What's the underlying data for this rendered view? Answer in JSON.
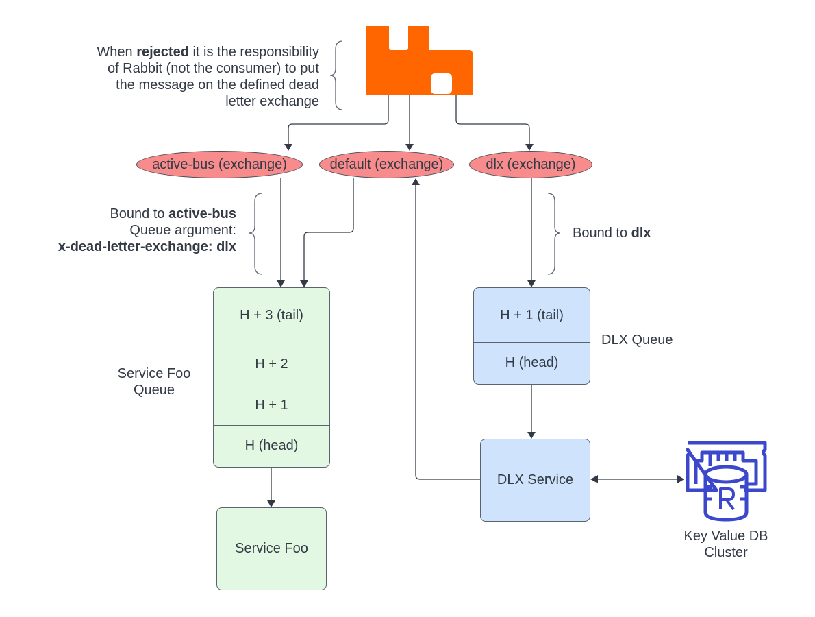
{
  "diagram": {
    "note_rejected": {
      "prefix": "When ",
      "bold": "rejected",
      "suffix_line1": " it is the responsibility",
      "line2": "of Rabbit (not the consumer) to put",
      "line3": "the message on the defined dead",
      "line4": "letter exchange"
    },
    "exchanges": [
      {
        "label": "active-bus (exchange)"
      },
      {
        "label": "default (exchange)"
      },
      {
        "label": "dlx (exchange)"
      }
    ],
    "note_bound_active": {
      "line1_prefix": "Bound to ",
      "line1_bold": "active-bus",
      "line2": "Queue argument:",
      "line3_bold": "x-dead-letter-exchange: dlx"
    },
    "note_bound_dlx": {
      "prefix": "Bound to ",
      "bold": "dlx"
    },
    "foo_queue": {
      "label_line1": "Service Foo",
      "label_line2": "Queue",
      "cells": [
        "H + 3 (tail)",
        "H + 2",
        "H + 1",
        "H (head)"
      ]
    },
    "dlx_queue": {
      "label": "DLX Queue",
      "cells": [
        "H + 1 (tail)",
        "H (head)"
      ]
    },
    "service_foo": {
      "label": "Service Foo"
    },
    "dlx_service": {
      "label": "DLX Service"
    },
    "kv_db": {
      "label_line1": "Key Value DB",
      "label_line2": "Cluster"
    },
    "colors": {
      "rabbit_orange": "#ff6600",
      "exchange_fill": "#f88c8c",
      "green_fill": "#e2f8e2",
      "blue_fill": "#cfe3fc",
      "db_icon": "#3b48cc",
      "line": "#333a45"
    }
  }
}
